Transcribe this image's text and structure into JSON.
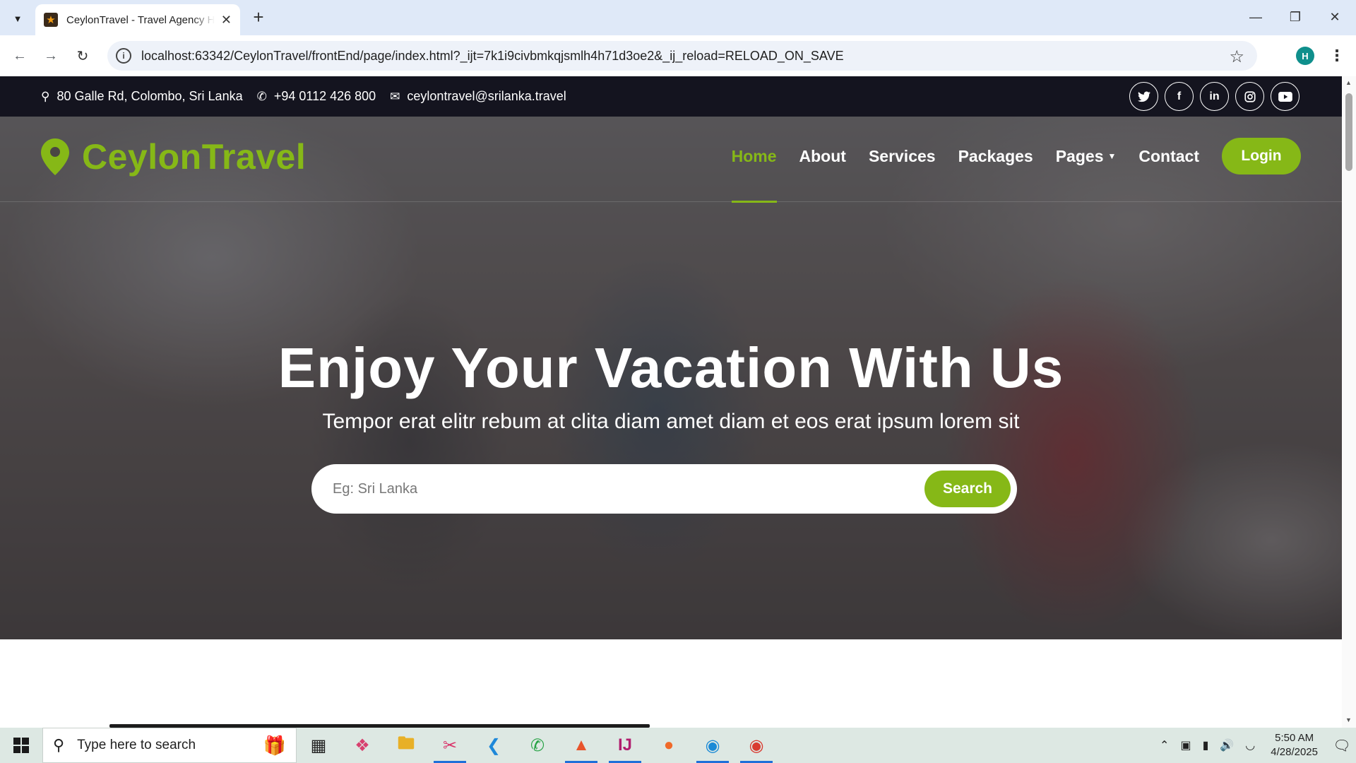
{
  "browser": {
    "tab_title": "CeylonTravel - Travel Agency HTML",
    "url": "localhost:63342/CeylonTravel/frontEnd/page/index.html?_ijt=7k1i9civbmkqjsmlh4h71d3oe2&_ij_reload=RELOAD_ON_SAVE",
    "profile_initial": "H"
  },
  "topbar": {
    "address": "80 Galle Rd, Colombo, Sri Lanka",
    "phone": "+94 0112 426 800",
    "email": "ceylontravel@srilanka.travel",
    "socials": [
      "twitter-icon",
      "facebook-icon",
      "linkedin-icon",
      "instagram-icon",
      "youtube-icon"
    ]
  },
  "navbar": {
    "brand": "CeylonTravel",
    "items": [
      {
        "label": "Home",
        "active": true
      },
      {
        "label": "About"
      },
      {
        "label": "Services"
      },
      {
        "label": "Packages"
      },
      {
        "label": "Pages",
        "dropdown": true
      },
      {
        "label": "Contact"
      }
    ],
    "login_label": "Login"
  },
  "hero": {
    "title": "Enjoy Your Vacation With Us",
    "subtitle": "Tempor erat elitr rebum at clita diam amet diam et eos erat ipsum lorem sit",
    "search_placeholder": "Eg: Sri Lanka",
    "search_button": "Search"
  },
  "taskbar": {
    "search_placeholder": "Type here to search",
    "time": "5:50 AM",
    "date": "4/28/2025"
  },
  "colors": {
    "accent": "#86b817",
    "topbar_bg": "#14141f"
  }
}
